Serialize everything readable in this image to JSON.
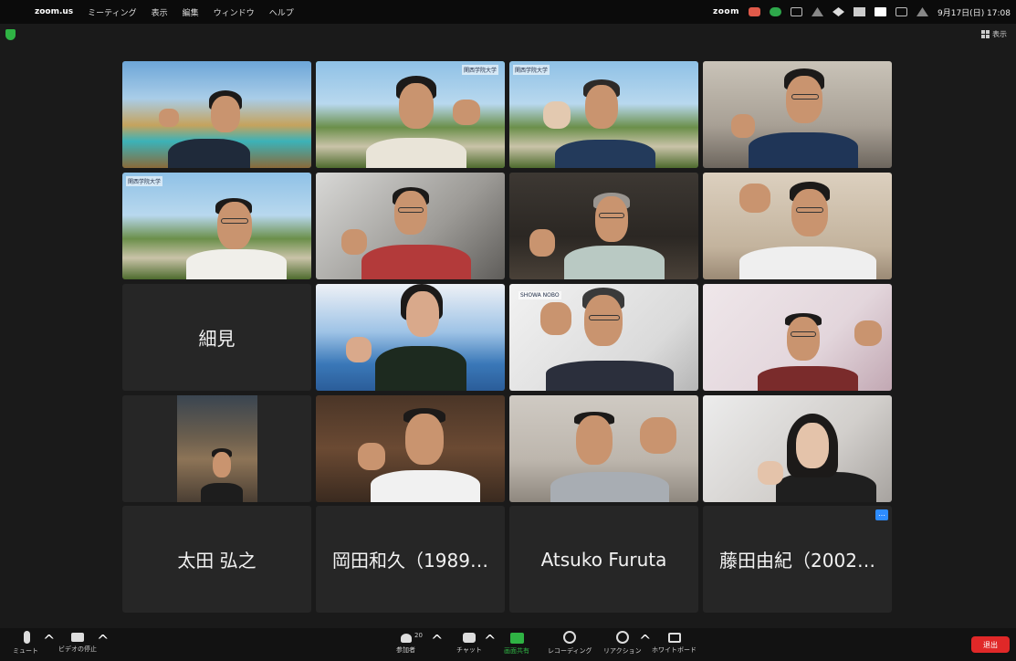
{
  "menubar": {
    "apple": "",
    "app_name": "zoom.us",
    "menus": [
      "ミーティング",
      "表示",
      "編集",
      "ウィンドウ",
      "ヘルプ"
    ],
    "zoom_word": "zoom",
    "datetime": "9月17日(日) 17:08"
  },
  "header": {
    "view_label": "表示"
  },
  "participants": [
    {
      "name": "",
      "feed": "lake",
      "speaking": false
    },
    {
      "name": "",
      "feed": "palms",
      "speaking": true
    },
    {
      "name": "",
      "feed": "palms",
      "speaking": false
    },
    {
      "name": "",
      "feed": "room",
      "speaking": false
    },
    {
      "name": "",
      "feed": "palms",
      "speaking": false
    },
    {
      "name": "",
      "feed": "grey",
      "speaking": false
    },
    {
      "name": "",
      "feed": "dark",
      "speaking": false
    },
    {
      "name": "",
      "feed": "beige",
      "speaking": false
    },
    {
      "name": "細見",
      "feed": "none",
      "speaking": false
    },
    {
      "name": "",
      "feed": "sea",
      "speaking": false
    },
    {
      "name": "",
      "feed": "white",
      "speaking": false
    },
    {
      "name": "",
      "feed": "pink",
      "speaking": false
    },
    {
      "name": "",
      "feed": "pip",
      "speaking": false
    },
    {
      "name": "",
      "feed": "brown",
      "speaking": false
    },
    {
      "name": "",
      "feed": "office",
      "speaking": false
    },
    {
      "name": "",
      "feed": "light",
      "speaking": false
    },
    {
      "name": "太田 弘之",
      "feed": "none",
      "speaking": false
    },
    {
      "name": "岡田和久（1989…",
      "feed": "none",
      "speaking": false
    },
    {
      "name": "Atsuko Furuta",
      "feed": "none",
      "speaking": false
    },
    {
      "name": "藤田由紀（2002…",
      "feed": "none",
      "speaking": false
    }
  ],
  "logos": {
    "university": "関西学院大学",
    "company": "SHOWA NOBO"
  },
  "more_button": "…",
  "toolbar": {
    "mute": "ミュート",
    "stop_video": "ビデオの停止",
    "participants": "参加者",
    "participants_count": "20",
    "chat": "チャット",
    "share": "画面共有",
    "record": "レコーディング",
    "reactions": "リアクション",
    "whiteboard": "ホワイトボード",
    "end": "退出"
  },
  "colors": {
    "speaking_outline": "#3ec14f",
    "share_green": "#2fb344",
    "end_red": "#e02828",
    "tile_bg": "#262626"
  }
}
